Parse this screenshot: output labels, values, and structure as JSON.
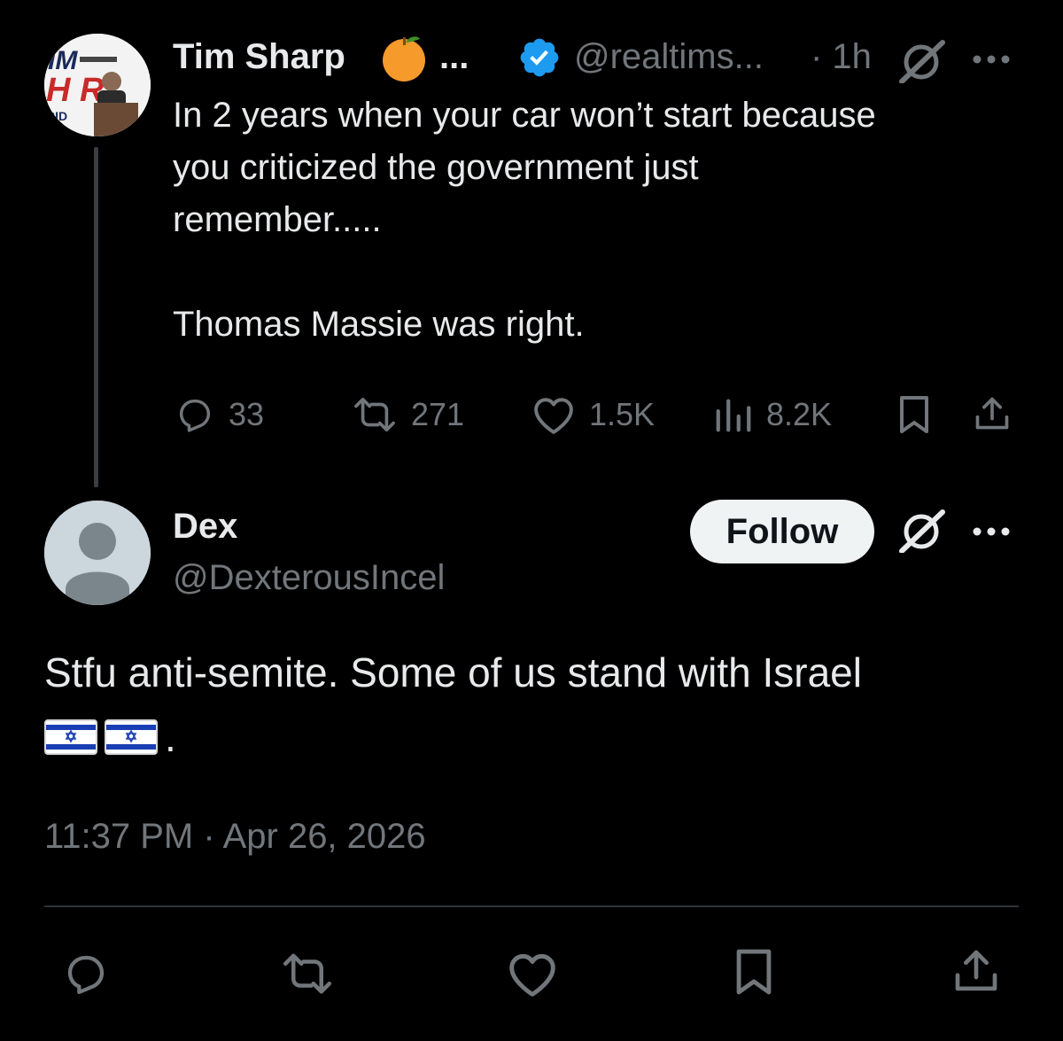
{
  "parent": {
    "name": "Tim Sharp",
    "name_emoji": "orange-icon",
    "ellipsis": "...",
    "handle": "@realtims...",
    "time": "· 1h",
    "text": "In 2 years when your car won’t start because\nyou criticized the government just\nremember.....\n\nThomas Massie was right.",
    "stats": {
      "replies": "33",
      "reposts": "271",
      "likes": "1.5K",
      "views": "8.2K"
    },
    "avatar_text": {
      "line1": "IM",
      "line2": "H  R",
      "line3": "RID"
    }
  },
  "reply": {
    "name": "Dex",
    "handle": "@DexterousIncel",
    "follow_label": "Follow",
    "text_line1": "Stfu anti-semite. Some of us stand with Israel",
    "text_tail": ".",
    "flags": [
      "israel-flag-icon",
      "israel-flag-icon"
    ],
    "timestamp": "11:37 PM · Apr 26, 2026"
  },
  "colors": {
    "background": "#000000",
    "text": "#e7e9ea",
    "muted": "#71767b",
    "verified": "#1d9bf0",
    "follow_bg": "#eff3f4",
    "divider": "#2f3336"
  }
}
